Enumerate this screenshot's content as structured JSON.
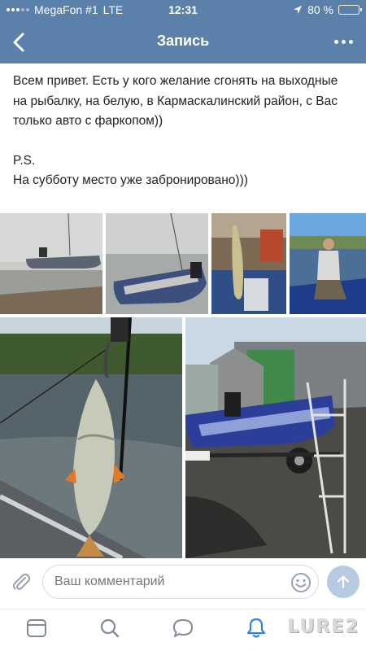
{
  "status_bar": {
    "carrier": "MegaFon #1",
    "network": "LTE",
    "time": "12:31",
    "battery_text": "80 %",
    "battery_level": 0.8
  },
  "nav": {
    "title": "Запись",
    "back_icon": "chevron-left-icon",
    "more_icon": "more-dots-icon"
  },
  "post": {
    "paragraph1": "Всем привет. Есть у кого желание сгонять на выходные на рыбалку, на белую, в Кармаскалинский район, с Вас только авто с фаркопом))",
    "ps": "P.S.",
    "ps_text": "На субботу место уже забронировано)))"
  },
  "photos": [
    {
      "subject": "inflatable boat on misty shore"
    },
    {
      "subject": "inflatable boat with motor on water"
    },
    {
      "subject": "pike held up in boat"
    },
    {
      "subject": "fisherman sitting in blue boat"
    },
    {
      "subject": "fish hanging on grip over river"
    },
    {
      "subject": "blue boat on trailer near garage"
    }
  ],
  "comment": {
    "placeholder": "Ваш комментарий",
    "attach_icon": "paperclip-icon",
    "emoji_icon": "smile-icon",
    "send_icon": "send-arrow-icon"
  },
  "tabs": [
    "news-icon",
    "search-icon",
    "messages-icon",
    "notifications-icon"
  ],
  "watermark": "LURE2",
  "colors": {
    "header": "#5b80a9",
    "accent": "#2d81e0",
    "send_inactive": "#b6cbe2"
  }
}
